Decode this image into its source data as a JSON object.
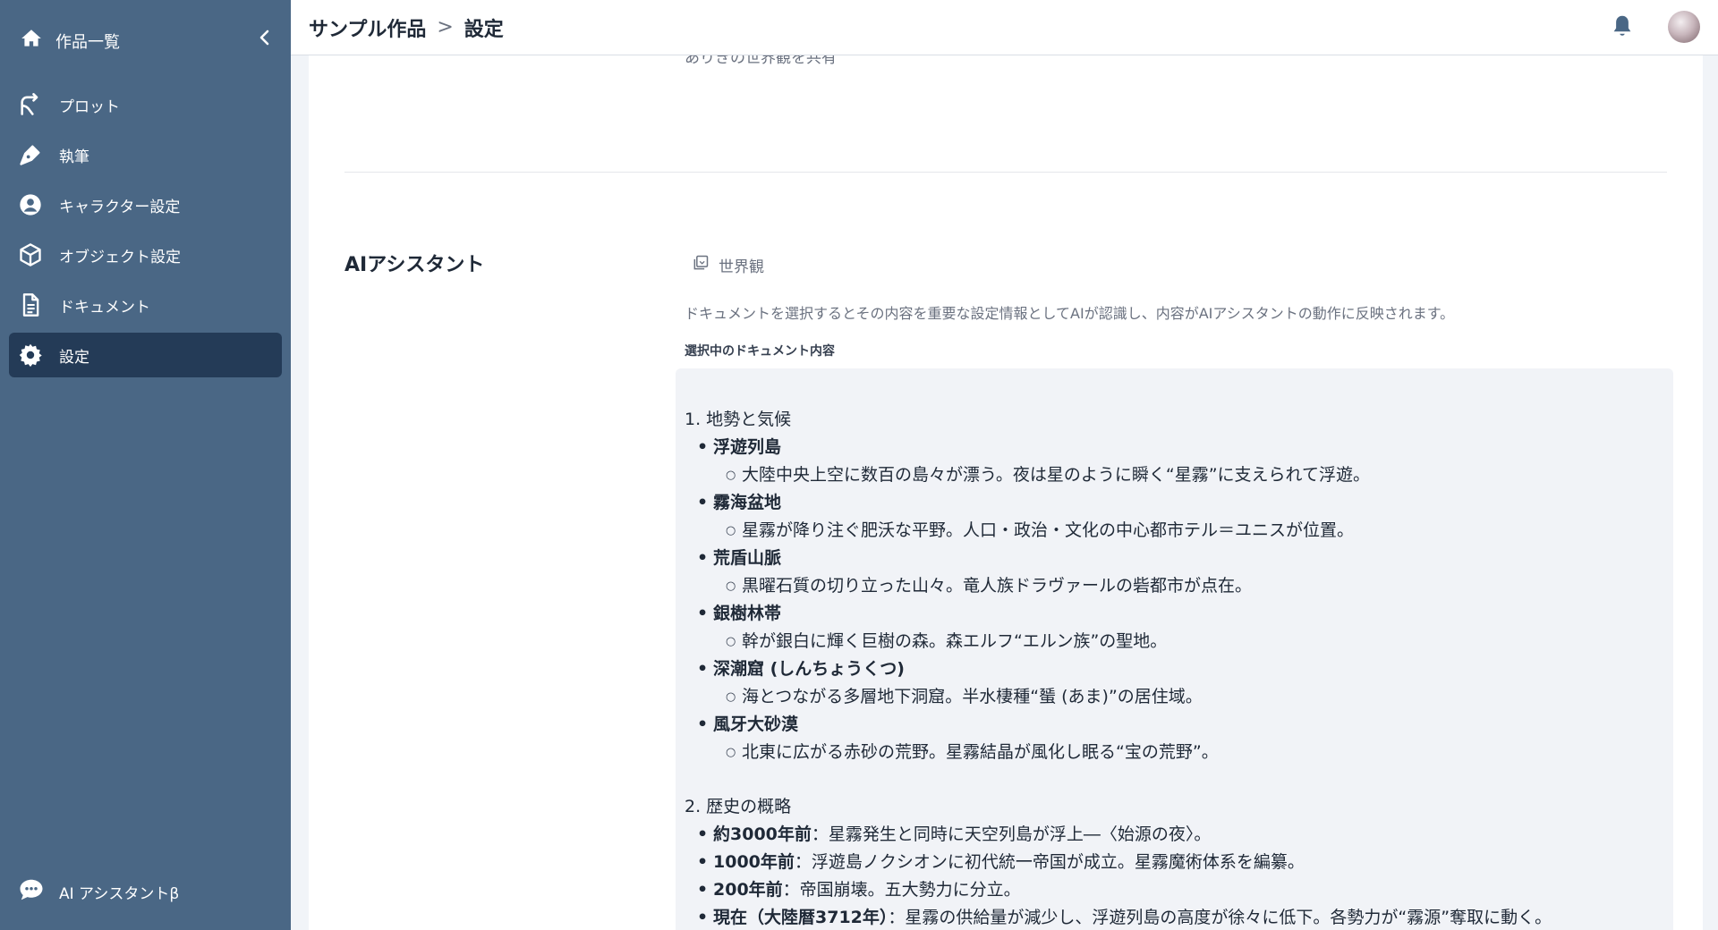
{
  "sidebar": {
    "home_label": "作品一覧",
    "items": [
      {
        "label": "プロット",
        "icon": "plot-branch-icon"
      },
      {
        "label": "執筆",
        "icon": "pen-icon"
      },
      {
        "label": "キャラクター設定",
        "icon": "user-circle-icon"
      },
      {
        "label": "オブジェクト設定",
        "icon": "cube-icon"
      },
      {
        "label": "ドキュメント",
        "icon": "document-icon"
      },
      {
        "label": "設定",
        "icon": "gear-icon",
        "active": true
      }
    ],
    "ai_label": "AI アシスタントβ"
  },
  "header": {
    "project": "サンプル作品",
    "separator": ">",
    "page": "設定"
  },
  "main": {
    "cut_text": "ありきの世界観を共有",
    "section_title": "AIアシスタント",
    "doc_tag": "世界観",
    "description": "ドキュメントを選択するとその内容を重要な設定情報としてAIが認識し、内容がAIアシスタントの動作に反映されます。",
    "doc_label": "選択中のドキュメント内容",
    "doc": {
      "h1": "1. 地勢と気候",
      "places": [
        {
          "name": "浮遊列島",
          "desc": "大陸中央上空に数百の島々が漂う。夜は星のように瞬く“星霧”に支えられて浮遊。"
        },
        {
          "name": "霧海盆地",
          "desc": "星霧が降り注ぐ肥沃な平野。人口・政治・文化の中心都市テル＝ユニスが位置。"
        },
        {
          "name": "荒盾山脈",
          "desc": "黒曜石質の切り立った山々。竜人族ドラヴァールの砦都市が点在。"
        },
        {
          "name": "銀樹林帯",
          "desc": "幹が銀白に輝く巨樹の森。森エルフ“エルン族”の聖地。"
        },
        {
          "name": "深潮窟 (しんちょうくつ)",
          "desc": "海とつながる多層地下洞窟。半水棲種“蜑 (あま)”の居住域。"
        },
        {
          "name": "風牙大砂漠",
          "desc": "北東に広がる赤砂の荒野。星霧結晶が風化し眠る“宝の荒野”。"
        }
      ],
      "h2": "2. 歴史の概略",
      "history": [
        {
          "era": "約3000年前",
          "text": "：星霧発生と同時に天空列島が浮上―〈始源の夜〉。"
        },
        {
          "era": "1000年前",
          "text": "：浮遊島ノクシオンに初代統一帝国が成立。星霧魔術体系を編纂。"
        },
        {
          "era": "200年前",
          "text": "：帝国崩壊。五大勢力に分立。"
        },
        {
          "era": "現在（大陸暦3712年）",
          "text": "：星霧の供給量が減少し、浮遊列島の高度が徐々に低下。各勢力が“霧源”奪取に動く。"
        }
      ]
    }
  },
  "colors": {
    "sidebar_bg": "#4a6785",
    "sidebar_active": "#243b57",
    "doc_box_bg": "#f1f3f7"
  }
}
